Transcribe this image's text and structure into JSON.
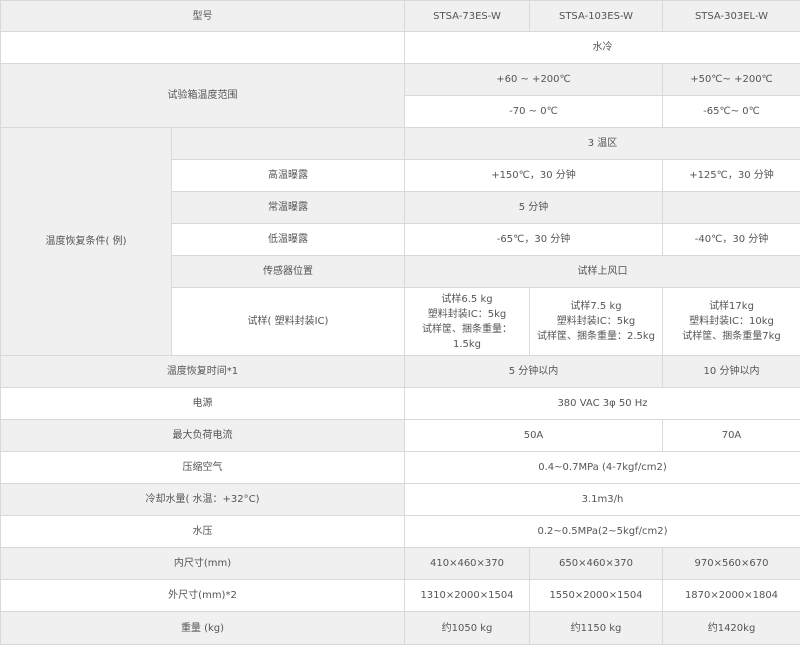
{
  "table": {
    "header": {
      "label": "型号",
      "models": [
        "STSA-73ES-W",
        "STSA-103ES-W",
        "STSA-303EL-W"
      ]
    },
    "cooling": {
      "label": "",
      "value": "水冷"
    },
    "temp_range": {
      "label": "试验箱温度范围",
      "high_a": "+60 ~ +200℃",
      "high_b": "+50℃~ +200℃",
      "low_a": "-70 ~ 0℃",
      "low_b": "-65℃~ 0℃"
    },
    "recovery": {
      "label": "温度恢复条件( 例)",
      "zones": "3 温区",
      "high_exposure": {
        "label": "高温曝露",
        "a": "+150℃，30 分钟",
        "b": "+125℃，30 分钟"
      },
      "normal_exposure": {
        "label": "常温曝露",
        "a": "5 分钟",
        "b": ""
      },
      "low_exposure": {
        "label": "低温曝露",
        "a": "-65℃，30 分钟",
        "b": "-40℃，30 分钟"
      },
      "sensor": {
        "label": "传感器位置",
        "value": "试样上风口"
      },
      "sample": {
        "label": "试样( 塑料封装IC)",
        "m1": [
          "试样6.5 kg",
          "塑料封装IC：5kg",
          "试样筐、捆条重量：",
          "1.5kg"
        ],
        "m2": [
          "试样7.5 kg",
          "塑料封装IC：5kg",
          "试样筐、捆条重量：2.5kg"
        ],
        "m3": [
          "试样17kg",
          "塑料封装IC：10kg",
          "试样筐、捆条重量7kg"
        ]
      }
    },
    "recovery_time": {
      "label": "温度恢复时间*1",
      "a": "5 分钟以内",
      "b": "10 分钟以内"
    },
    "power": {
      "label": "电源",
      "value": "380 VAC 3φ 50 Hz"
    },
    "max_current": {
      "label": "最大负荷电流",
      "a": "50A",
      "b": "70A"
    },
    "compressed_air": {
      "label": "压缩空气",
      "value": "0.4~0.7MPa (4-7kgf/cm2)"
    },
    "cooling_water": {
      "label": "冷却水量( 水温：+32°C)",
      "value": "3.1m3/h"
    },
    "water_pressure": {
      "label": "水压",
      "value": "0.2~0.5MPa(2~5kgf/cm2)"
    },
    "inner_size": {
      "label": "内尺寸(mm)",
      "values": [
        "410×460×370",
        "650×460×370",
        "970×560×670"
      ]
    },
    "outer_size": {
      "label": "外尺寸(mm)*2",
      "values": [
        "1310×2000×1504",
        "1550×2000×1504",
        "1870×2000×1804"
      ]
    },
    "weight": {
      "label": "重量 (kg)",
      "values": [
        "约1050 kg",
        "约1150 kg",
        "约1420kg"
      ]
    }
  }
}
